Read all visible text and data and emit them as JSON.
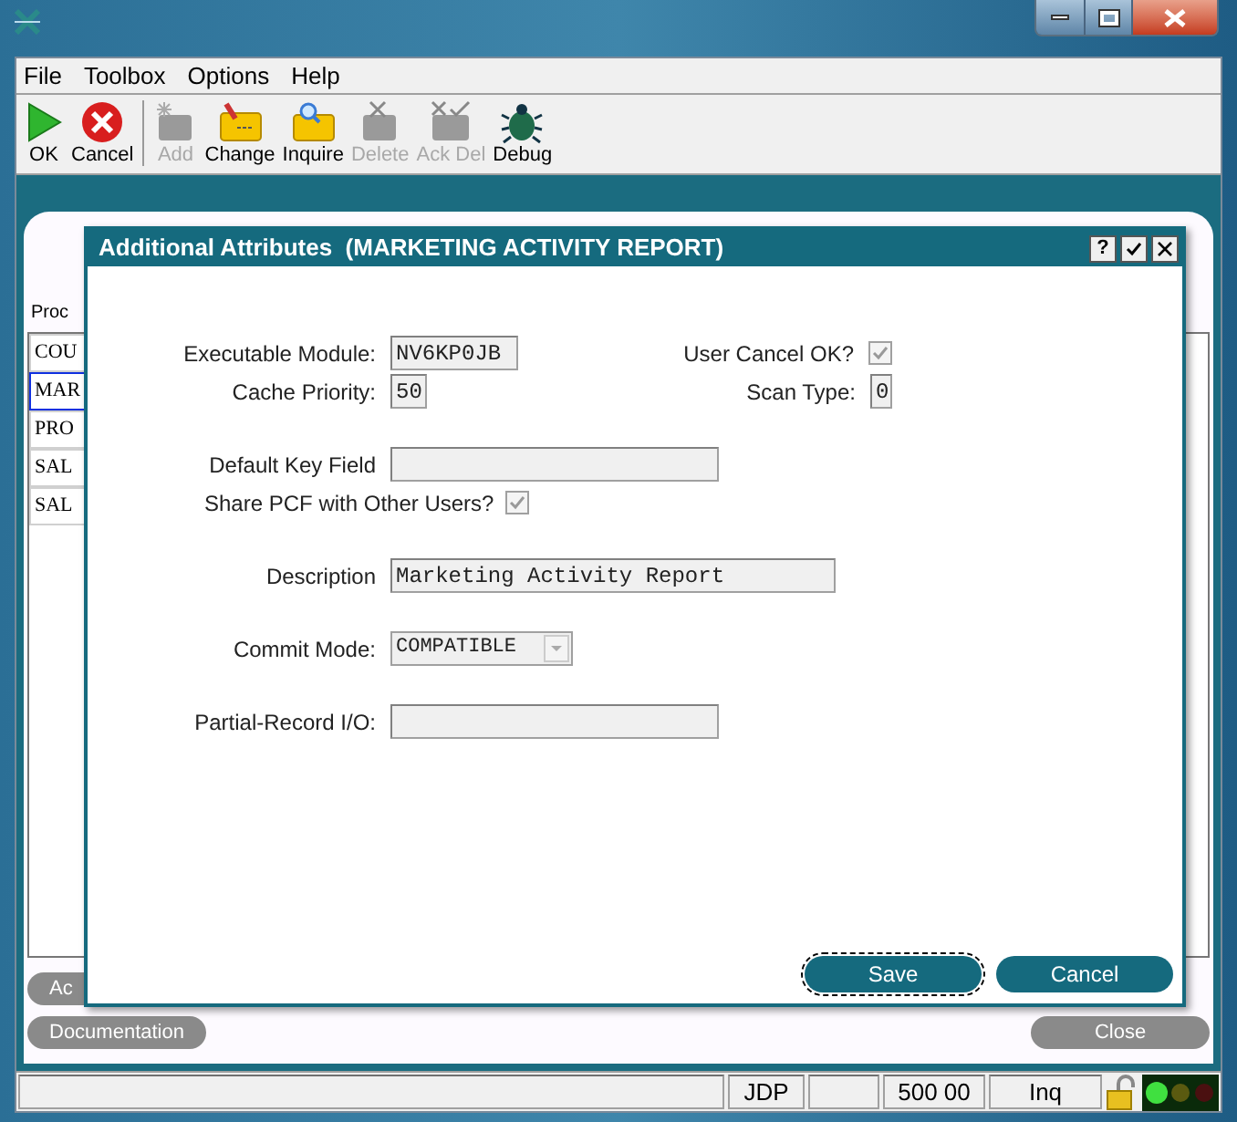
{
  "menu": [
    "File",
    "Toolbox",
    "Options",
    "Help"
  ],
  "toolbar": [
    {
      "label": "OK",
      "kind": "ok",
      "disabled": false
    },
    {
      "label": "Cancel",
      "kind": "cancel",
      "disabled": false
    },
    {
      "label": "Add",
      "kind": "add",
      "disabled": true
    },
    {
      "label": "Change",
      "kind": "change",
      "disabled": false
    },
    {
      "label": "Inquire",
      "kind": "inquire",
      "disabled": false
    },
    {
      "label": "Delete",
      "kind": "delete",
      "disabled": true
    },
    {
      "label": "Ack Del",
      "kind": "ackdel",
      "disabled": true
    },
    {
      "label": "Debug",
      "kind": "debug",
      "disabled": false
    }
  ],
  "background": {
    "list_header": "Proc",
    "rows": [
      {
        "text": "COU",
        "selected": false
      },
      {
        "text": "MAR",
        "selected": true
      },
      {
        "text": "PRO",
        "selected": false
      },
      {
        "text": "SAL",
        "selected": false
      },
      {
        "text": "SAL",
        "selected": false
      }
    ],
    "buttons_left": [
      "Ac",
      "Documentation"
    ],
    "button_right": "Close"
  },
  "dialog": {
    "title": "Additional Attributes  (MARKETING ACTIVITY REPORT)",
    "title_buttons": [
      "?"
    ],
    "groups": [
      [
        {
          "left": {
            "label": "Executable Module:",
            "kind": "text",
            "value": "NV6KP0JB"
          },
          "right": {
            "label": "User Cancel OK?",
            "kind": "checkbox",
            "checked": true
          }
        },
        {
          "left": {
            "label": "Cache Priority:",
            "kind": "text",
            "value": "50"
          },
          "right": {
            "label": "Scan Type:",
            "kind": "text",
            "value": "0"
          }
        }
      ],
      [
        {
          "left": {
            "label": "Default Key Field",
            "kind": "text"
          }
        },
        {
          "left": {
            "label": "Share PCF with Other Users?",
            "kind": "checkbox",
            "checked": true
          }
        }
      ],
      [
        {
          "left": {
            "label": "Description",
            "kind": "text",
            "value": "Marketing Activity Report"
          }
        }
      ],
      [
        {
          "left": {
            "label": "Commit Mode:",
            "kind": "select",
            "value": "COMPATIBLE"
          }
        }
      ],
      [
        {
          "left": {
            "label": "Partial-Record I/O:",
            "kind": "text"
          }
        }
      ]
    ],
    "buttons": [
      "Save",
      "Cancel"
    ]
  },
  "status_bar": [
    "JDP",
    "500 00",
    "Inq"
  ]
}
